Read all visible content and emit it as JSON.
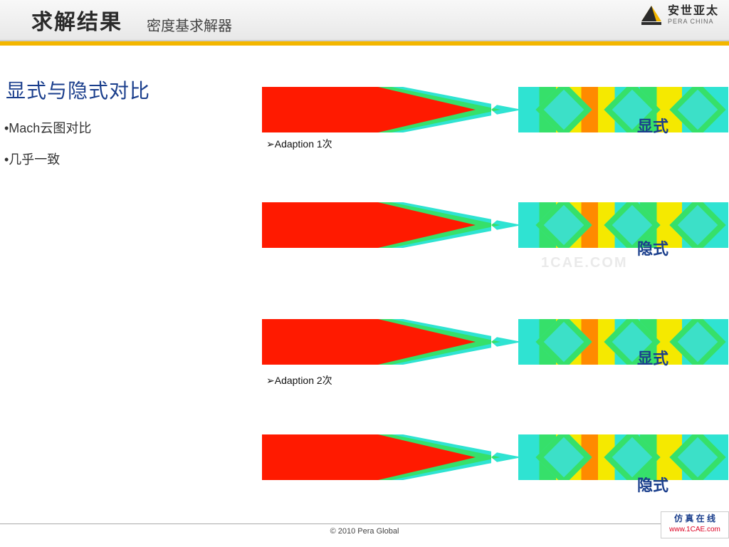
{
  "header": {
    "title": "求解结果",
    "subtitle": "密度基求解器",
    "logo_main": "安世亚太",
    "logo_sub": "PERA CHINA"
  },
  "content": {
    "heading": "显式与隐式对比",
    "bullets": [
      "•Mach云图对比",
      "•几乎一致"
    ],
    "figure1_caption": "➢Adaption 1次",
    "figure2_caption": "➢Adaption 2次",
    "label_explicit": "显式",
    "label_implicit": "隐式",
    "watermark": "1CAE.COM"
  },
  "footer": {
    "copyright": "© 2010 Pera Global",
    "badge_title": "仿 真 在 线",
    "badge_url": "www.1CAE.com"
  }
}
